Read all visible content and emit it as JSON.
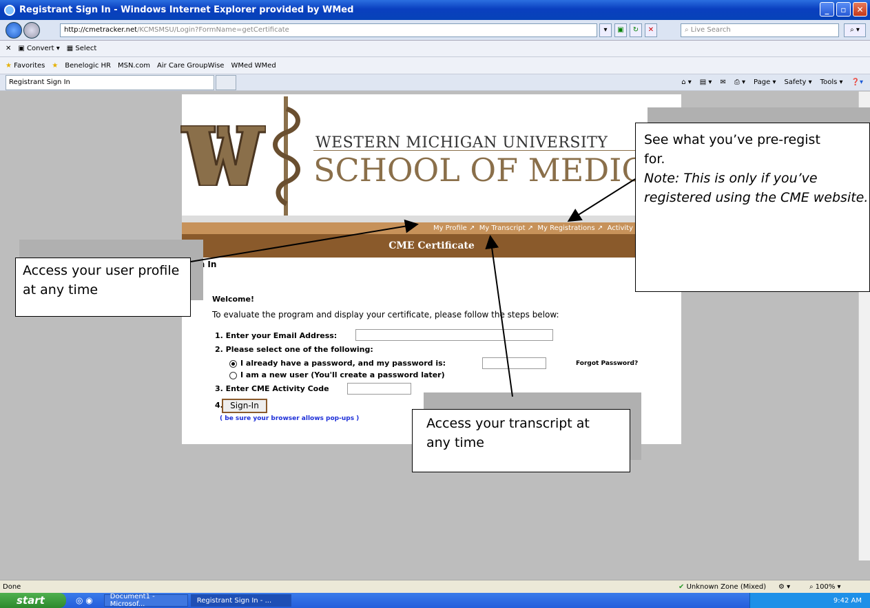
{
  "window": {
    "title": "Registrant Sign In - Windows Internet Explorer provided by WMed"
  },
  "address_bar": {
    "url_host": "http://cmetracker.net",
    "url_path": "/KCMSMSU/Login?FormName=getCertificate",
    "search_placeholder": "Live Search"
  },
  "toolbar1": {
    "convert_label": "Convert",
    "select_label": "Select"
  },
  "favorites_bar": {
    "favorites_label": "Favorites",
    "links": [
      "Benelogic HR",
      "MSN.com",
      "Air Care GroupWise",
      "WMed WMed"
    ]
  },
  "tabs": {
    "active_tab": "Registrant Sign In",
    "commands": [
      "Page",
      "Safety",
      "Tools"
    ]
  },
  "banner": {
    "line1": "WESTERN MICHIGAN UNIVERSITY",
    "line2": "SCHOOL OF MEDICI"
  },
  "nav_links": [
    "My Profile",
    "My Transcript",
    "My Registrations",
    "Activity"
  ],
  "cert_title": "CME Certificate",
  "form": {
    "signin_heading": "ign In",
    "welcome": "Welcome!",
    "instructions": "To evaluate the program and display your certificate, please follow the steps below:",
    "step1": "1. Enter your Email Address:",
    "step2": "2. Please select one of the following:",
    "option_have_password": "I already have a password, and my password is:",
    "option_new_user": "I am a new user (You'll create a password later)",
    "forgot_password": "Forgot Password?",
    "step3": "3. Enter CME Activity Code",
    "step4": "4.",
    "signin_button": "Sign-In",
    "popup_note": "( be sure your browser allows pop-ups )"
  },
  "callouts": {
    "profile": "Access your user profile at any time",
    "transcript": "Access your transcript at any time",
    "registrations_line1": "See what you’ve pre-regist",
    "registrations_line2": "for.",
    "registrations_note": "Note:  This is only if you’ve registered using the CME website."
  },
  "status_bar": {
    "status": "Done",
    "zone": "Unknown Zone (Mixed)",
    "zoom": "100%"
  },
  "taskbar": {
    "start": "start",
    "tasks": [
      "Document1 - Microsof...",
      "Registrant Sign In - ..."
    ],
    "clock": "9:42 AM"
  },
  "colors": {
    "brown_dark": "#8a5a2b",
    "brown_light": "#c7925a",
    "xp_blue": "#245edb"
  }
}
